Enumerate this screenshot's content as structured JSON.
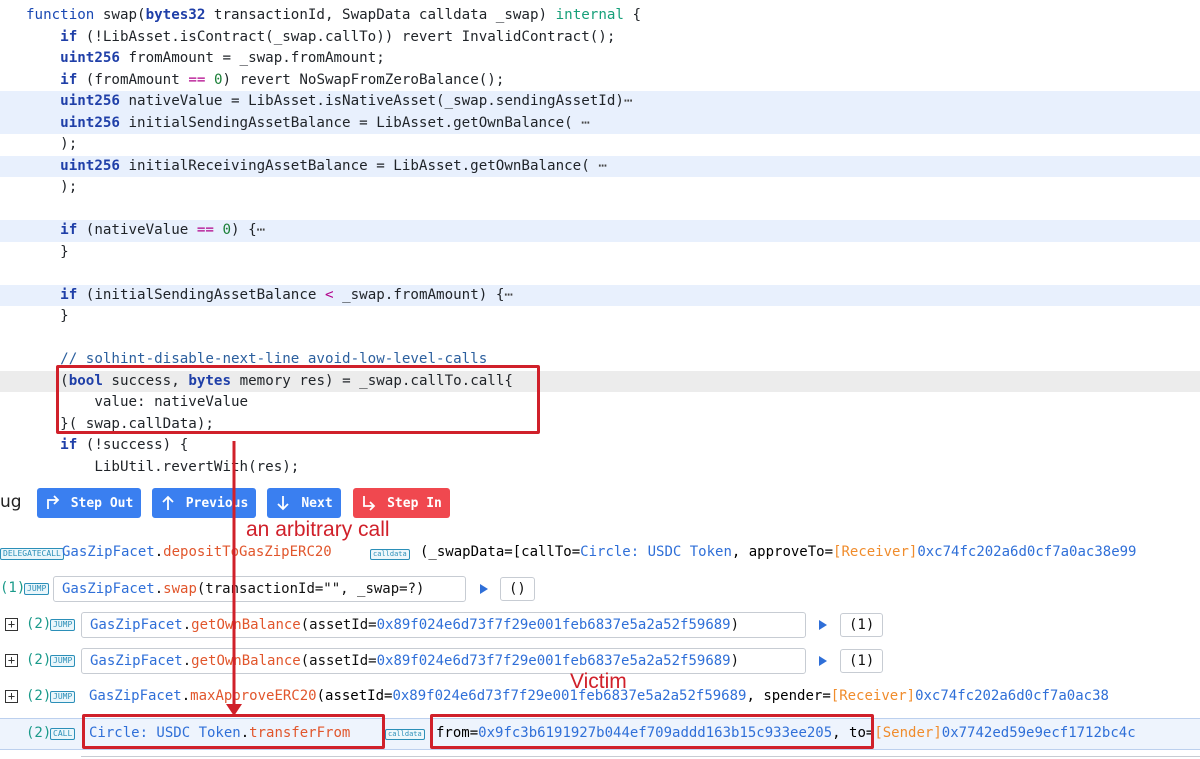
{
  "editor": {
    "lines": [
      {
        "parts": [
          [
            "fnkw",
            "function "
          ],
          [
            "",
            "swap("
          ],
          [
            "kw",
            "bytes32"
          ],
          [
            "",
            " transactionId, SwapData calldata _swap) "
          ],
          [
            "mod",
            "internal"
          ],
          [
            "",
            " {"
          ]
        ]
      },
      {
        "parts": [
          [
            "",
            "    "
          ],
          [
            "kw",
            "if"
          ],
          [
            "",
            " (!LibAsset.isContract(_swap.callTo)) revert InvalidContract();"
          ]
        ]
      },
      {
        "parts": [
          [
            "",
            "    "
          ],
          [
            "kw",
            "uint256"
          ],
          [
            "",
            " fromAmount = _swap.fromAmount;"
          ]
        ]
      },
      {
        "parts": [
          [
            "",
            "    "
          ],
          [
            "kw",
            "if"
          ],
          [
            "",
            " (fromAmount "
          ],
          [
            "op",
            "=="
          ],
          [
            "",
            ""
          ],
          [
            "num",
            " 0"
          ],
          [
            "",
            ") revert NoSwapFromZeroBalance();"
          ]
        ]
      },
      {
        "parts": [
          [
            "",
            "    "
          ],
          [
            "kw",
            "uint256"
          ],
          [
            "",
            " nativeValue = LibAsset.isNativeAsset(_swap.sendingAssetId)"
          ],
          [
            "ell",
            "⋯"
          ]
        ]
      },
      {
        "parts": [
          [
            "",
            "    "
          ],
          [
            "kw",
            "uint256"
          ],
          [
            "",
            " initialSendingAssetBalance = LibAsset.getOwnBalance( "
          ],
          [
            "ell",
            "⋯"
          ]
        ]
      },
      {
        "parts": [
          [
            "",
            "    );"
          ]
        ]
      },
      {
        "parts": [
          [
            "",
            "    "
          ],
          [
            "kw",
            "uint256"
          ],
          [
            "",
            " initialReceivingAssetBalance = LibAsset.getOwnBalance( "
          ],
          [
            "ell",
            "⋯"
          ]
        ]
      },
      {
        "parts": [
          [
            "",
            "    );"
          ]
        ]
      },
      {
        "parts": [
          [
            "",
            ""
          ]
        ]
      },
      {
        "parts": [
          [
            "",
            "    "
          ],
          [
            "kw",
            "if"
          ],
          [
            "",
            " (nativeValue "
          ],
          [
            "op",
            "=="
          ],
          [
            "num",
            " 0"
          ],
          [
            "",
            ") {"
          ],
          [
            "ell",
            "⋯"
          ]
        ]
      },
      {
        "parts": [
          [
            "",
            "    }"
          ]
        ]
      },
      {
        "parts": [
          [
            "",
            ""
          ]
        ]
      },
      {
        "parts": [
          [
            "",
            "    "
          ],
          [
            "kw",
            "if"
          ],
          [
            "",
            " (initialSendingAssetBalance "
          ],
          [
            "op",
            "<"
          ],
          [
            "",
            " _swap.fromAmount) {"
          ],
          [
            "ell",
            "⋯"
          ]
        ]
      },
      {
        "parts": [
          [
            "",
            "    }"
          ]
        ]
      },
      {
        "parts": [
          [
            "",
            ""
          ]
        ]
      },
      {
        "parts": [
          [
            "",
            "    "
          ],
          [
            "cm",
            "// solhint-disable-next-line avoid-low-level-calls"
          ]
        ]
      },
      {
        "parts": [
          [
            "",
            "    ("
          ],
          [
            "kw",
            "bool"
          ],
          [
            "",
            " success, "
          ],
          [
            "kw",
            "bytes"
          ],
          [
            "",
            " memory res) = _swap.callTo.call{"
          ]
        ]
      },
      {
        "parts": [
          [
            "",
            "        value: nativeValue"
          ]
        ]
      },
      {
        "parts": [
          [
            "",
            "    }(_swap.callData);"
          ]
        ]
      },
      {
        "parts": [
          [
            "",
            "    "
          ],
          [
            "kw",
            "if"
          ],
          [
            "",
            " (!success) {"
          ]
        ]
      },
      {
        "parts": [
          [
            "",
            "        LibUtil.revertWith(res);"
          ]
        ]
      }
    ]
  },
  "toolbar": {
    "debug_label": "ug",
    "step_out": "Step Out",
    "previous": "Previous",
    "next": "Next",
    "step_in": "Step In"
  },
  "trace": {
    "row1": {
      "badge": "DELEGATECALL",
      "contract": "GasZipFacet",
      "method": "depositToGasZipERC20",
      "calldata": "calldata",
      "args_pre": "(_swapData=[callTo=",
      "callto": "Circle: USDC Token",
      "args_mid": ", approveTo=",
      "receiver": "[Receiver]",
      "recv_addr": "0xc74fc202a6d0cf7a0ac38e99"
    },
    "row2": {
      "depth": "(1)",
      "badge": "JUMP",
      "contract": "GasZipFacet",
      "method": "swap",
      "args": "(transactionId=\"\", _swap=?)",
      "ret": "()"
    },
    "row3": {
      "expand": "+",
      "depth": "(2)",
      "badge": "JUMP",
      "contract": "GasZipFacet",
      "method": "getOwnBalance",
      "args_pre": "(assetId=",
      "addr": "0x89f024e6d73f7f29e001feb6837e5a2a52f59689",
      "args_post": ")",
      "ret": "(1)"
    },
    "row4": {
      "expand": "+",
      "depth": "(2)",
      "badge": "JUMP",
      "contract": "GasZipFacet",
      "method": "getOwnBalance",
      "args_pre": "(assetId=",
      "addr": "0x89f024e6d73f7f29e001feb6837e5a2a52f59689",
      "args_post": ")",
      "ret": "(1)"
    },
    "row5": {
      "expand": "+",
      "depth": "(2)",
      "badge": "JUMP",
      "contract": "GasZipFacet",
      "method": "maxApproveERC20",
      "args_pre": "(assetId=",
      "addr": "0x89f024e6d73f7f29e001feb6837e5a2a52f59689",
      "args_mid": ", spender=",
      "receiver": "[Receiver]",
      "recv_addr": "0xc74fc202a6d0cf7a0ac38"
    },
    "row6": {
      "depth": "(2)",
      "badge": "CALL",
      "contract": "Circle: USDC Token",
      "method": "transferFrom",
      "calldata": "calldata",
      "from_label": "from=",
      "from_addr": "0x9fc3b6191927b044ef709addd163b15c933ee205",
      "to_label": ", to=",
      "sender": "[Sender]",
      "to_addr": "0x7742ed59e9ecf1712bc4c"
    }
  },
  "annotations": {
    "arbitrary_call": "an arbitrary call",
    "victim": "Victim",
    "color": "#d0202a"
  }
}
